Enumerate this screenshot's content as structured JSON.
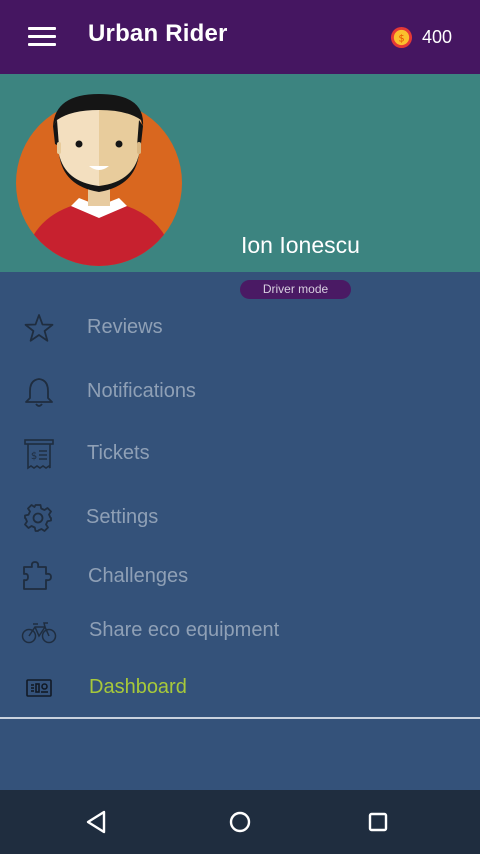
{
  "app": {
    "title": "Urban Rider",
    "coins": "400"
  },
  "profile": {
    "name": "Ion Ionescu",
    "mode_badge": "Driver mode"
  },
  "menu": {
    "items": [
      {
        "label": "Reviews",
        "icon": "star-icon"
      },
      {
        "label": "Notifications",
        "icon": "bell-icon"
      },
      {
        "label": "Tickets",
        "icon": "receipt-icon"
      },
      {
        "label": "Settings",
        "icon": "gear-icon"
      },
      {
        "label": "Challenges",
        "icon": "puzzle-icon"
      },
      {
        "label": "Share eco equipment",
        "icon": "bicycle-icon"
      },
      {
        "label": "Dashboard",
        "icon": "dashboard-icon",
        "active": true
      }
    ]
  },
  "colors": {
    "appbar": "#451661",
    "profile_bg": "#3c8480",
    "drawer_bg": "#34527a",
    "active_label": "#a7c93a",
    "navbar": "#1f2d3f"
  }
}
